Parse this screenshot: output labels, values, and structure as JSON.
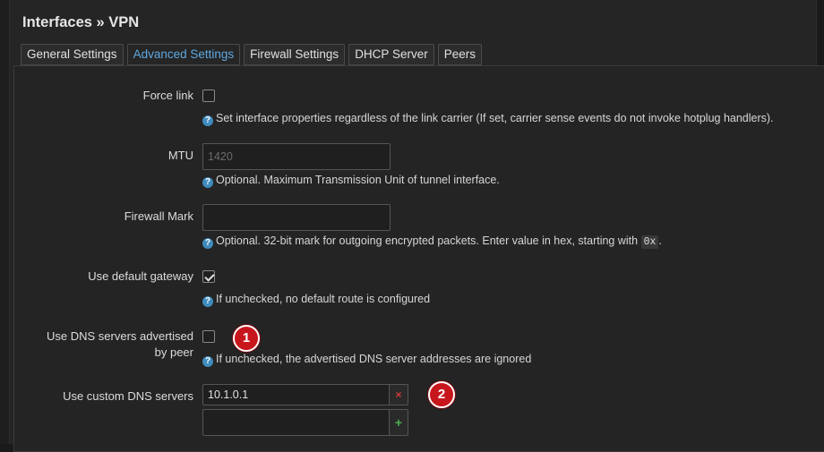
{
  "modal": {
    "title": "Interfaces » VPN"
  },
  "tabs": [
    {
      "label": "General Settings",
      "active": false
    },
    {
      "label": "Advanced Settings",
      "active": true
    },
    {
      "label": "Firewall Settings",
      "active": false
    },
    {
      "label": "DHCP Server",
      "active": false
    },
    {
      "label": "Peers",
      "active": false
    }
  ],
  "fields": {
    "force_link": {
      "label": "Force link",
      "checked": false,
      "help": "Set interface properties regardless of the link carrier (If set, carrier sense events do not invoke hotplug handlers)."
    },
    "mtu": {
      "label": "MTU",
      "value": "",
      "placeholder": "1420",
      "help": "Optional. Maximum Transmission Unit of tunnel interface."
    },
    "firewall_mark": {
      "label": "Firewall Mark",
      "value": "",
      "help_prefix": "Optional. 32-bit mark for outgoing encrypted packets. Enter value in hex, starting with ",
      "help_code": "0x",
      "help_suffix": "."
    },
    "default_gateway": {
      "label": "Use default gateway",
      "checked": true,
      "help": "If unchecked, no default route is configured"
    },
    "peer_dns": {
      "label_line1": "Use DNS servers advertised",
      "label_line2": "by peer",
      "checked": false,
      "help": "If unchecked, the advertised DNS server addresses are ignored"
    },
    "custom_dns": {
      "label": "Use custom DNS servers",
      "entries": [
        "10.1.0.1"
      ],
      "new_value": "",
      "remove_icon": "×",
      "add_icon": "+"
    }
  },
  "help_icon": "?",
  "annotations": {
    "badge1": "1",
    "badge2": "2",
    "badge_color": "#c8161d"
  },
  "colors": {
    "accent": "#5fa8e0",
    "help_icon": "#3f8bbd"
  }
}
